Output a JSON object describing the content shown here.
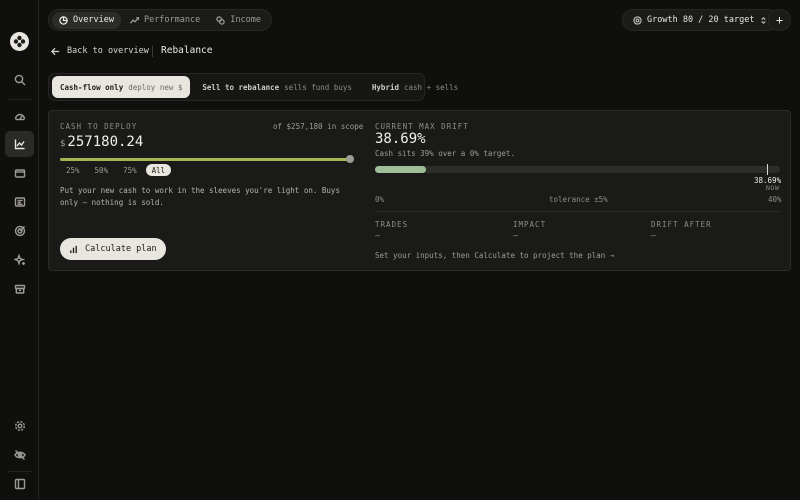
{
  "nav": {
    "tabs": [
      {
        "label": "Overview",
        "icon": "pie-chart-icon",
        "active": true
      },
      {
        "label": "Performance",
        "icon": "trend-line-icon",
        "active": false
      },
      {
        "label": "Income",
        "icon": "coins-icon",
        "active": false
      }
    ],
    "portfolio_label": "Growth 80 / 20 target",
    "add_label": "+"
  },
  "breadcrumb": {
    "back_label": "Back to overview",
    "title": "Rebalance"
  },
  "modes": [
    {
      "name": "Cash-flow only",
      "hint": "deploy new $",
      "active": true
    },
    {
      "name": "Sell to rebalance",
      "hint": "sells fund buys",
      "active": false
    },
    {
      "name": "Hybrid",
      "hint": "cash + sells",
      "active": false
    }
  ],
  "cash": {
    "label": "CASH TO DEPLOY",
    "scope": "of $257,180 in scope",
    "currency": "$",
    "value": "257180.24",
    "slider_fraction": 1.0,
    "chips": [
      {
        "label": "25%",
        "active": false
      },
      {
        "label": "50%",
        "active": false
      },
      {
        "label": "75%",
        "active": false
      },
      {
        "label": "All",
        "active": true
      }
    ],
    "description": "Put your new cash to work in the sleeves you're light on. Buys only — nothing is sold.",
    "calculate_label": "Calculate plan"
  },
  "drift": {
    "label": "CURRENT MAX DRIFT",
    "value": "38.69%",
    "subtitle": "Cash sits 39% over a 0% target.",
    "tolerance_fraction": 0.125,
    "current_fraction": 0.967,
    "marker_value": "38.69%",
    "marker_note": "NOW",
    "axis_min": "0%",
    "axis_mid": "tolerance ±5%",
    "axis_max": "40%"
  },
  "stats": [
    {
      "label": "TRADES",
      "value": "—"
    },
    {
      "label": "IMPACT",
      "value": "—"
    },
    {
      "label": "DRIFT AFTER",
      "value": "—"
    }
  ],
  "hint": "Set your inputs, then Calculate to project the plan →",
  "colors": {
    "accent_olive": "#a8b356",
    "drift_green": "#9fbf9b",
    "surface": "#1a1a18",
    "active_chip": "#e8e6df"
  }
}
